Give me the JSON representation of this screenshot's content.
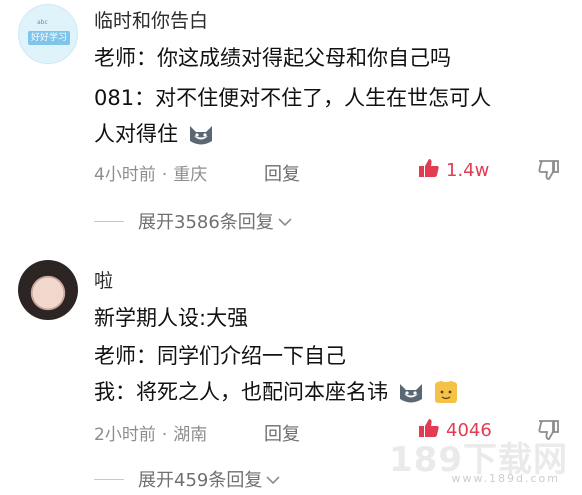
{
  "comments": [
    {
      "username": "临时和你告白",
      "avatar_text": "好好学习",
      "lines": [
        "老师：你这成绩对得起父母和你自己吗",
        "081：对不住便对不住了，人生在世怎可人",
        "人对得住"
      ],
      "time": "4小时前",
      "location": "重庆",
      "reply_label": "回复",
      "likes": "1.4w",
      "expand_label": "展开3586条回复"
    },
    {
      "username": "啦",
      "lines": [
        "新学期人设:大强",
        "老师：同学们介绍一下自己",
        "我：将死之人，也配问本座名讳"
      ],
      "time": "2小时前",
      "location": "湖南",
      "reply_label": "回复",
      "likes": "4046",
      "expand_label": "展开459条回复"
    }
  ],
  "watermark": {
    "brand": "189下载网",
    "url": "www.189d.com"
  },
  "colors": {
    "like": "#e23c52",
    "meta": "#8d8d8d"
  },
  "icons": [
    "thumb-up-icon",
    "thumb-down-icon",
    "chevron-down-icon",
    "cat-emoji-icon",
    "mouse-emoji-icon"
  ]
}
